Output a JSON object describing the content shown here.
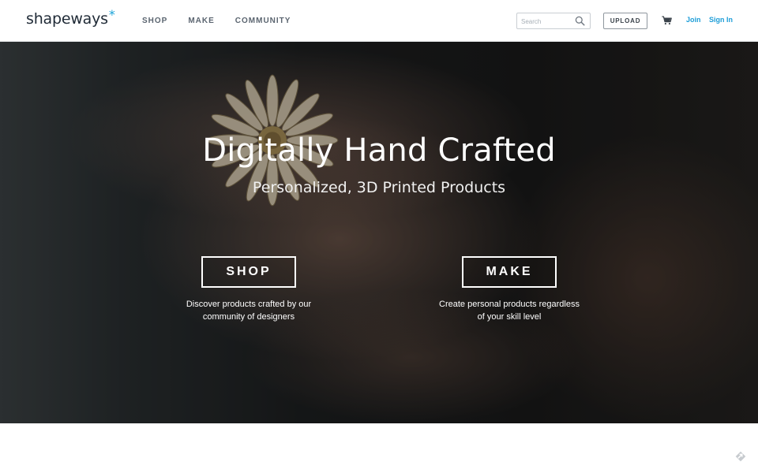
{
  "header": {
    "logo_text": "shapeways",
    "logo_mark": "*",
    "nav": [
      "SHOP",
      "MAKE",
      "COMMUNITY"
    ],
    "search_placeholder": "Search",
    "upload_label": "UPLOAD",
    "cart_icon": "cart-icon",
    "join_label": "Join",
    "signin_label": "Sign In"
  },
  "hero": {
    "title": "Digitally Hand Crafted",
    "subtitle": "Personalized, 3D Printed Products",
    "shop": {
      "button_label": "SHOP",
      "description_line1": "Discover products crafted by our",
      "description_line2": "community of designers"
    },
    "make": {
      "button_label": "MAKE",
      "description_line1": "Create personal products regardless",
      "description_line2": "of your skill level"
    }
  },
  "colors": {
    "accent": "#1f9ed8",
    "header_bg": "#ffffff",
    "text_dark": "#1f2a36"
  }
}
